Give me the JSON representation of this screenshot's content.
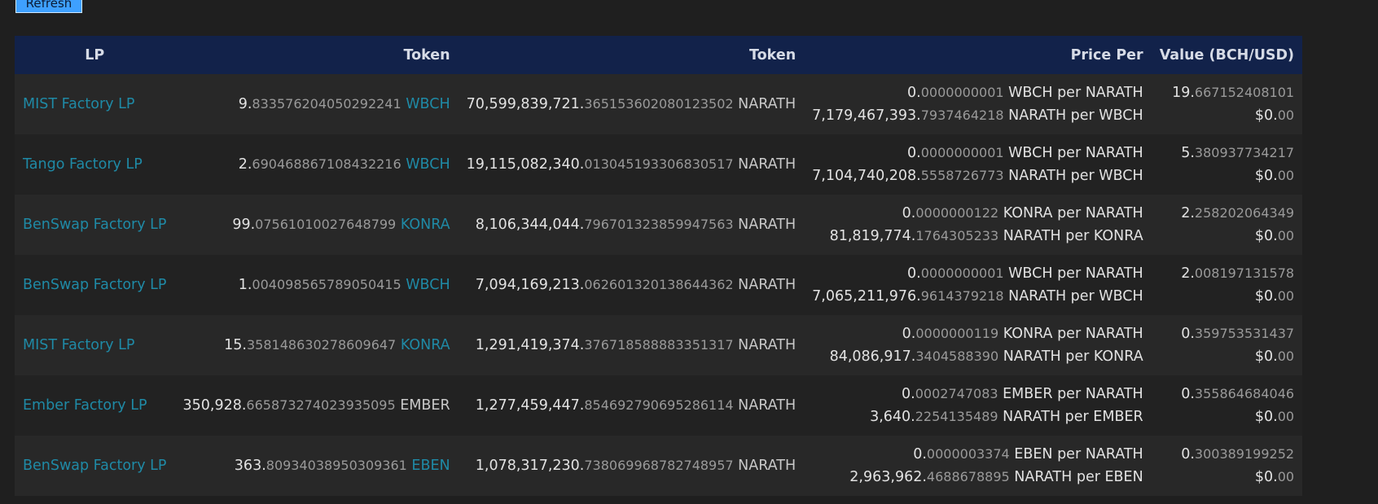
{
  "toolbar": {
    "refresh_label": "Refresh"
  },
  "table": {
    "headers": {
      "lp": "LP",
      "token1": "Token",
      "token2": "Token",
      "price": "Price Per",
      "value": "Value (BCH/USD)"
    },
    "rows": [
      {
        "lp": "MIST Factory LP",
        "t1_int": "9.",
        "t1_frac": "833576204050292241",
        "t1_sym": "WBCH",
        "t2_int": "70,599,839,721.",
        "t2_frac": "365153602080123502",
        "t2_sym": "NARATH",
        "p1_int": "0.",
        "p1_frac": "0000000001",
        "p1_unit": "WBCH per NARATH",
        "p2_int": "7,179,467,393.",
        "p2_frac": "7937464218",
        "p2_unit": "NARATH per WBCH",
        "v1_int": "19.",
        "v1_frac": "667152408101",
        "v2_int": "$0.",
        "v2_frac": "00"
      },
      {
        "lp": "Tango Factory LP",
        "t1_int": "2.",
        "t1_frac": "690468867108432216",
        "t1_sym": "WBCH",
        "t2_int": "19,115,082,340.",
        "t2_frac": "013045193306830517",
        "t2_sym": "NARATH",
        "p1_int": "0.",
        "p1_frac": "0000000001",
        "p1_unit": "WBCH per NARATH",
        "p2_int": "7,104,740,208.",
        "p2_frac": "5558726773",
        "p2_unit": "NARATH per WBCH",
        "v1_int": "5.",
        "v1_frac": "380937734217",
        "v2_int": "$0.",
        "v2_frac": "00"
      },
      {
        "lp": "BenSwap Factory LP",
        "t1_int": "99.",
        "t1_frac": "07561010027648799",
        "t1_sym": "KONRA",
        "t2_int": "8,106,344,044.",
        "t2_frac": "796701323859947563",
        "t2_sym": "NARATH",
        "p1_int": "0.",
        "p1_frac": "0000000122",
        "p1_unit": "KONRA per NARATH",
        "p2_int": "81,819,774.",
        "p2_frac": "1764305233",
        "p2_unit": "NARATH per KONRA",
        "v1_int": "2.",
        "v1_frac": "258202064349",
        "v2_int": "$0.",
        "v2_frac": "00"
      },
      {
        "lp": "BenSwap Factory LP",
        "t1_int": "1.",
        "t1_frac": "004098565789050415",
        "t1_sym": "WBCH",
        "t2_int": "7,094,169,213.",
        "t2_frac": "062601320138644362",
        "t2_sym": "NARATH",
        "p1_int": "0.",
        "p1_frac": "0000000001",
        "p1_unit": "WBCH per NARATH",
        "p2_int": "7,065,211,976.",
        "p2_frac": "9614379218",
        "p2_unit": "NARATH per WBCH",
        "v1_int": "2.",
        "v1_frac": "008197131578",
        "v2_int": "$0.",
        "v2_frac": "00"
      },
      {
        "lp": "MIST Factory LP",
        "t1_int": "15.",
        "t1_frac": "358148630278609647",
        "t1_sym": "KONRA",
        "t2_int": "1,291,419,374.",
        "t2_frac": "376718588883351317",
        "t2_sym": "NARATH",
        "p1_int": "0.",
        "p1_frac": "0000000119",
        "p1_unit": "KONRA per NARATH",
        "p2_int": "84,086,917.",
        "p2_frac": "3404588390",
        "p2_unit": "NARATH per KONRA",
        "v1_int": "0.",
        "v1_frac": "359753531437",
        "v2_int": "$0.",
        "v2_frac": "00"
      },
      {
        "lp": "Ember Factory LP",
        "t1_int": "350,928.",
        "t1_frac": "665873274023935095",
        "t1_sym": "EMBER",
        "t2_int": "1,277,459,447.",
        "t2_frac": "854692790695286114",
        "t2_sym": "NARATH",
        "p1_int": "0.",
        "p1_frac": "0002747083",
        "p1_unit": "EMBER per NARATH",
        "p2_int": "3,640.",
        "p2_frac": "2254135489",
        "p2_unit": "NARATH per EMBER",
        "v1_int": "0.",
        "v1_frac": "355864684046",
        "v2_int": "$0.",
        "v2_frac": "00"
      },
      {
        "lp": "BenSwap Factory LP",
        "t1_int": "363.",
        "t1_frac": "80934038950309361",
        "t1_sym": "EBEN",
        "t2_int": "1,078,317,230.",
        "t2_frac": "738069968782748957",
        "t2_sym": "NARATH",
        "p1_int": "0.",
        "p1_frac": "0000003374",
        "p1_unit": "EBEN per NARATH",
        "p2_int": "2,963,962.",
        "p2_frac": "4688678895",
        "p2_unit": "NARATH per EBEN",
        "v1_int": "0.",
        "v1_frac": "300389199252",
        "v2_int": "$0.",
        "v2_frac": "00"
      }
    ]
  },
  "colors": {
    "background": "#1f1f1f",
    "header_bg": "#12224a",
    "link": "#1f8aa6",
    "button": "#3ea0ff"
  }
}
